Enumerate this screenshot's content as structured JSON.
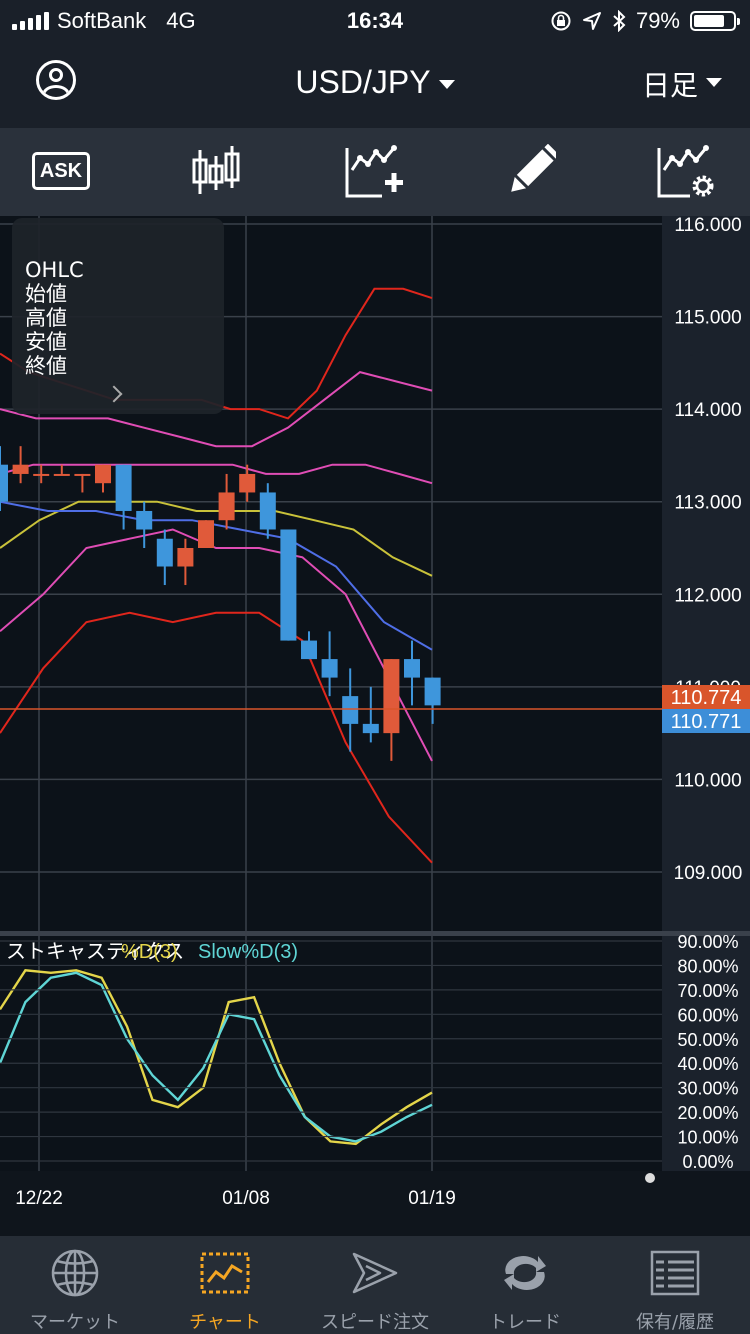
{
  "status_bar": {
    "carrier": "SoftBank",
    "network": "4G",
    "time": "16:34",
    "battery": "79%",
    "battery_level": 0.79
  },
  "header": {
    "pair": "USD/JPY",
    "period": "日足"
  },
  "toolbar": {
    "ask_label": "ASK",
    "icons": [
      "candlestick-icon",
      "add-indicator-icon",
      "pencil-icon",
      "indicator-settings-icon"
    ]
  },
  "ohlc_panel": {
    "title": "OHLC",
    "labels": [
      "始値",
      "高値",
      "安値",
      "終値"
    ]
  },
  "price_chart": {
    "price_axis_labels": [
      "116.000",
      "115.000",
      "114.000",
      "113.000",
      "112.000",
      "111.000",
      "110.000",
      "109.000"
    ],
    "ask_price": "110.774",
    "bid_price": "110.771",
    "colors": {
      "up": "#e05a3a",
      "down": "#3e96dc",
      "bb_outer": "#e0261c",
      "bb_mid": "#e04db5",
      "ma": "#c9c23a",
      "ma2": "#4f6ee6",
      "ask": "#d9552b",
      "bid": "#3d8ed8"
    }
  },
  "stochastic": {
    "title": "ストキャスティクス",
    "d_label": "%D(3)",
    "slow_label": "Slow%D(3)",
    "axis_labels": [
      "90.00%",
      "80.00%",
      "70.00%",
      "60.00%",
      "50.00%",
      "40.00%",
      "30.00%",
      "20.00%",
      "10.00%",
      "0.00%"
    ],
    "colors": {
      "d": "#e4d54a",
      "slow": "#5fd5d5"
    }
  },
  "date_labels": [
    "12/22",
    "01/08",
    "01/19"
  ],
  "chart_data": {
    "type": "candlestick",
    "y_range": [
      109.0,
      116.0
    ],
    "candles": [
      {
        "o": 113.4,
        "h": 113.6,
        "l": 112.9,
        "c": 113.0
      },
      {
        "o": 113.3,
        "h": 113.6,
        "l": 113.2,
        "c": 113.4
      },
      {
        "o": 113.3,
        "h": 113.4,
        "l": 113.2,
        "c": 113.3
      },
      {
        "o": 113.3,
        "h": 113.4,
        "l": 113.3,
        "c": 113.3
      },
      {
        "o": 113.3,
        "h": 113.3,
        "l": 113.1,
        "c": 113.3
      },
      {
        "o": 113.2,
        "h": 113.4,
        "l": 113.1,
        "c": 113.4
      },
      {
        "o": 113.4,
        "h": 113.4,
        "l": 112.7,
        "c": 112.9
      },
      {
        "o": 112.9,
        "h": 113.0,
        "l": 112.5,
        "c": 112.7
      },
      {
        "o": 112.6,
        "h": 112.7,
        "l": 112.1,
        "c": 112.3
      },
      {
        "o": 112.3,
        "h": 112.6,
        "l": 112.1,
        "c": 112.5
      },
      {
        "o": 112.5,
        "h": 112.8,
        "l": 112.5,
        "c": 112.8
      },
      {
        "o": 112.8,
        "h": 113.3,
        "l": 112.7,
        "c": 113.1
      },
      {
        "o": 113.1,
        "h": 113.4,
        "l": 113.0,
        "c": 113.3
      },
      {
        "o": 113.1,
        "h": 113.2,
        "l": 112.6,
        "c": 112.7
      },
      {
        "o": 112.7,
        "h": 112.7,
        "l": 111.5,
        "c": 111.5
      },
      {
        "o": 111.5,
        "h": 111.6,
        "l": 111.3,
        "c": 111.3
      },
      {
        "o": 111.3,
        "h": 111.6,
        "l": 110.9,
        "c": 111.1
      },
      {
        "o": 110.9,
        "h": 111.2,
        "l": 110.3,
        "c": 110.6
      },
      {
        "o": 110.6,
        "h": 111.0,
        "l": 110.4,
        "c": 110.5
      },
      {
        "o": 110.5,
        "h": 111.3,
        "l": 110.2,
        "c": 111.3
      },
      {
        "o": 111.3,
        "h": 111.5,
        "l": 110.8,
        "c": 111.1
      },
      {
        "o": 111.1,
        "h": 111.1,
        "l": 110.6,
        "c": 110.8
      }
    ],
    "bb_upper2": [
      114.6,
      114.4,
      114.3,
      114.2,
      114.1,
      114.1,
      114.1,
      114.1,
      114.0,
      114.0,
      113.9,
      114.2,
      114.8,
      115.3,
      115.3,
      115.2
    ],
    "bb_upper1": [
      114.0,
      113.9,
      113.9,
      113.9,
      113.8,
      113.7,
      113.6,
      113.6,
      113.8,
      114.1,
      114.4,
      114.3,
      114.2
    ],
    "bb_mid_upper": [
      113.3,
      113.4,
      113.4,
      113.4,
      113.4,
      113.4,
      113.4,
      113.4,
      113.3,
      113.3,
      113.4,
      113.4,
      113.3,
      113.2
    ],
    "ma_yellow": [
      112.5,
      112.8,
      113.0,
      113.0,
      113.0,
      112.9,
      112.9,
      112.9,
      112.8,
      112.7,
      112.4,
      112.2
    ],
    "ma_blue": [
      113.0,
      112.9,
      112.9,
      112.8,
      112.8,
      112.7,
      112.6,
      112.3,
      111.7,
      111.4
    ],
    "bb_lower1": [
      111.6,
      112.0,
      112.5,
      112.6,
      112.7,
      112.5,
      112.5,
      112.4,
      112.0,
      111.1,
      110.2
    ],
    "bb_lower2": [
      110.5,
      111.2,
      111.7,
      111.8,
      111.7,
      111.8,
      111.8,
      111.5,
      110.4,
      109.6,
      109.1
    ],
    "stochastic": {
      "d": [
        62,
        78,
        77,
        78,
        75,
        55,
        25,
        22,
        30,
        65,
        67,
        40,
        18,
        8,
        7,
        15,
        22,
        28
      ],
      "slow_d": [
        40,
        65,
        75,
        77,
        72,
        50,
        35,
        25,
        38,
        60,
        58,
        35,
        18,
        10,
        8,
        12,
        18,
        23
      ]
    }
  },
  "tabs": [
    {
      "label": "マーケット",
      "icon": "globe-icon",
      "active": false
    },
    {
      "label": "チャート",
      "icon": "chart-icon",
      "active": true
    },
    {
      "label": "スピード注文",
      "icon": "speed-order-icon",
      "active": false
    },
    {
      "label": "トレード",
      "icon": "trade-icon",
      "active": false
    },
    {
      "label": "保有/履歴",
      "icon": "list-icon",
      "active": false
    }
  ]
}
